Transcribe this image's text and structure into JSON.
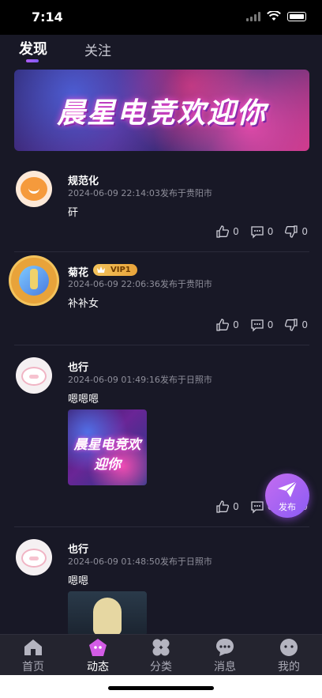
{
  "status_bar": {
    "time": "7:14"
  },
  "tabs": [
    {
      "label": "发现",
      "active": true
    },
    {
      "label": "关注",
      "active": false
    }
  ],
  "banner": {
    "text": "晨星电竞欢迎你"
  },
  "posts": [
    {
      "name": "规范化",
      "meta": "2024-06-09 22:14:03发布于贵阳市",
      "content": "矸",
      "likes": "0",
      "comments": "0",
      "dislikes": "0"
    },
    {
      "name": "菊花",
      "vip": "VIP1",
      "meta": "2024-06-09 22:06:36发布于贵阳市",
      "content": "补补女",
      "likes": "0",
      "comments": "0",
      "dislikes": "0"
    },
    {
      "name": "也行",
      "meta": "2024-06-09 01:49:16发布于日照市",
      "content": "嗯嗯嗯",
      "image_text": "晨星电竞欢迎你",
      "likes": "0",
      "comments": "0",
      "dislikes": "0"
    },
    {
      "name": "也行",
      "meta": "2024-06-09 01:48:50发布于日照市",
      "content": "嗯嗯"
    }
  ],
  "fab": {
    "label": "发布"
  },
  "nav": [
    {
      "label": "首页",
      "icon": "home-icon"
    },
    {
      "label": "动态",
      "icon": "moments-icon",
      "active": true
    },
    {
      "label": "分类",
      "icon": "category-icon"
    },
    {
      "label": "消息",
      "icon": "message-icon"
    },
    {
      "label": "我的",
      "icon": "profile-icon"
    }
  ],
  "colors": {
    "background": "#181826",
    "accent": "#a55cf5",
    "vip_gold": "#f3c35c"
  }
}
